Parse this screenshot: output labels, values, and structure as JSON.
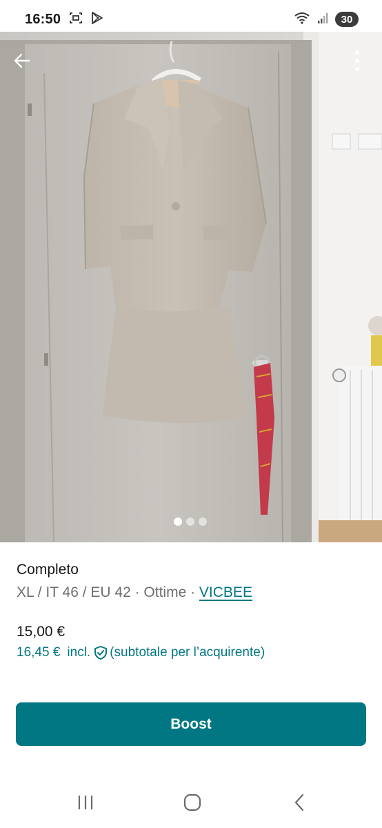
{
  "status_bar": {
    "time": "16:50",
    "battery": "30",
    "icons": [
      "screenshot-icon",
      "play-store-icon",
      "wifi-icon",
      "signal-icon"
    ]
  },
  "photo": {
    "icons": {
      "back": "arrow-left-icon",
      "more": "more-vertical-icon"
    },
    "dots_total": 3,
    "dots_active_index": 0
  },
  "item": {
    "title": "Completo",
    "meta": "XL / IT 46 / EU 42 · Ottime · ",
    "brand": "VICBEE",
    "price": "15,00 €",
    "price_incl_value": "16,45 €",
    "price_incl_label": "incl.",
    "price_incl_note": "(subtotale per l’acquirente)"
  },
  "actions": {
    "boost_label": "Boost"
  },
  "colors": {
    "accent": "#007782",
    "text_primary": "#171717",
    "text_secondary": "#6e6e6e"
  }
}
